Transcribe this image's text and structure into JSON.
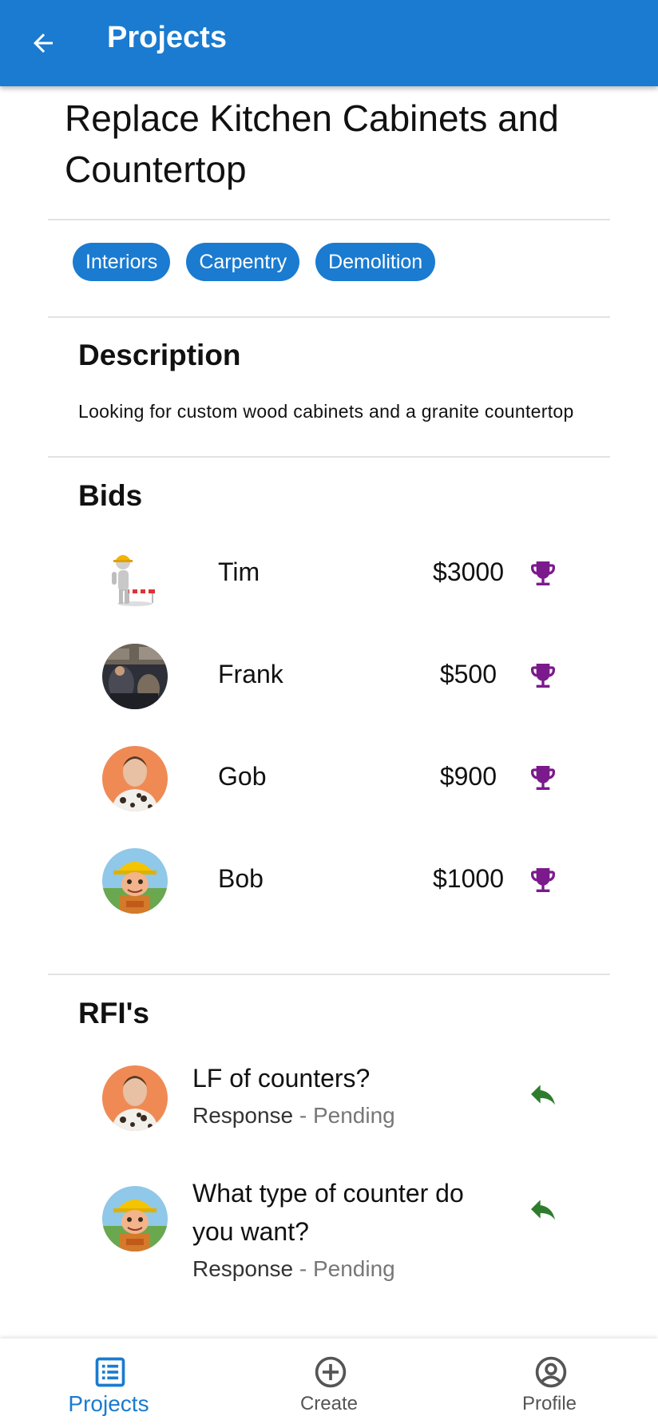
{
  "appbar": {
    "title": "Projects",
    "back_icon": "arrow-back-icon"
  },
  "project": {
    "title": "Replace Kitchen Cabinets and Countertop",
    "tags": [
      "Interiors",
      "Carpentry",
      "Demolition"
    ]
  },
  "description": {
    "heading": "Description",
    "text": "Looking for custom wood cabinets and a granite countertop"
  },
  "bids": {
    "heading": "Bids",
    "items": [
      {
        "name": "Tim",
        "amount": "$3000",
        "icon": "trophy-icon"
      },
      {
        "name": "Frank",
        "amount": "$500",
        "icon": "trophy-icon"
      },
      {
        "name": "Gob",
        "amount": "$900",
        "icon": "trophy-icon"
      },
      {
        "name": "Bob",
        "amount": "$1000",
        "icon": "trophy-icon"
      }
    ]
  },
  "rfis": {
    "heading": "RFI's",
    "items": [
      {
        "question": "LF of counters?",
        "status_label": "Response",
        "status_value": " - Pending",
        "icon": "reply-icon"
      },
      {
        "question": "What type of counter do you want?",
        "status_label": "Response",
        "status_value": " - Pending",
        "icon": "reply-icon"
      }
    ]
  },
  "nav": {
    "items": [
      {
        "label": "Projects",
        "icon": "list-icon",
        "active": true
      },
      {
        "label": "Create",
        "icon": "add-circle-icon",
        "active": false
      },
      {
        "label": "Profile",
        "icon": "account-circle-icon",
        "active": false
      }
    ]
  },
  "colors": {
    "primary": "#1a7bd0",
    "trophy": "#7b1a8c",
    "reply": "#2e7d2e",
    "divider": "#e2e2e2"
  }
}
